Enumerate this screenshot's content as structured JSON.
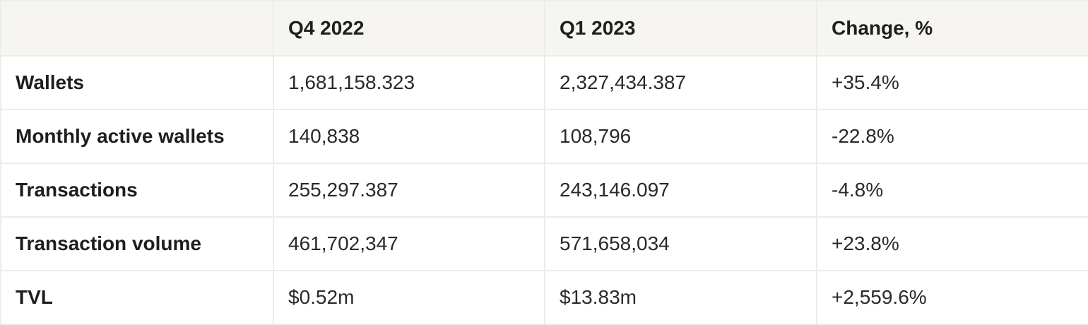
{
  "table": {
    "headers": [
      "",
      "Q4 2022",
      "Q1 2023",
      "Change, %"
    ],
    "rows": [
      {
        "label": "Wallets",
        "q4_2022": "1,681,158.323",
        "q1_2023": "2,327,434.387",
        "change": "+35.4%"
      },
      {
        "label": "Monthly active wallets",
        "q4_2022": "140,838",
        "q1_2023": "108,796",
        "change": "-22.8%"
      },
      {
        "label": "Transactions",
        "q4_2022": "255,297.387",
        "q1_2023": "243,146.097",
        "change": "-4.8%"
      },
      {
        "label": "Transaction volume",
        "q4_2022": "461,702,347",
        "q1_2023": "571,658,034",
        "change": "+23.8%"
      },
      {
        "label": "TVL",
        "q4_2022": "$0.52m",
        "q1_2023": "$13.83m",
        "change": "+2,559.6%"
      }
    ]
  },
  "colors": {
    "header_background": "#f6f5f2",
    "border": "#ececea",
    "text": "#1e1e1e"
  }
}
